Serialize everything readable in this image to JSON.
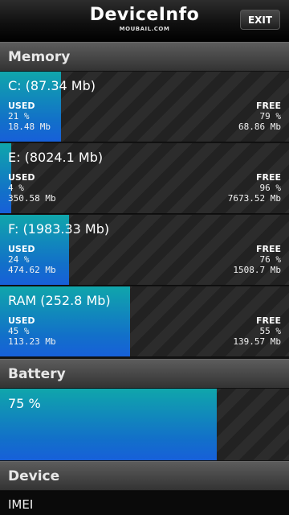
{
  "header": {
    "title": "DeviceInfo",
    "subtitle": "MOUBAIL.COM",
    "exit_label": "EXIT"
  },
  "sections": {
    "memory": "Memory",
    "battery": "Battery",
    "device": "Device"
  },
  "labels": {
    "used": "USED",
    "free": "FREE"
  },
  "memory": [
    {
      "title": "C: (87.34 Mb)",
      "used_pct": "21 %",
      "used_size": "18.48 Mb",
      "free_pct": "79 %",
      "free_size": "68.86 Mb",
      "used_fraction": 0.21
    },
    {
      "title": "E: (8024.1 Mb)",
      "used_pct": "4 %",
      "used_size": "350.58 Mb",
      "free_pct": "96 %",
      "free_size": "7673.52 Mb",
      "used_fraction": 0.04
    },
    {
      "title": "F: (1983.33 Mb)",
      "used_pct": "24 %",
      "used_size": "474.62 Mb",
      "free_pct": "76 %",
      "free_size": "1508.7 Mb",
      "used_fraction": 0.24
    },
    {
      "title": "RAM (252.8 Mb)",
      "used_pct": "45 %",
      "used_size": "113.23 Mb",
      "free_pct": "55 %",
      "free_size": "139.57 Mb",
      "used_fraction": 0.45
    }
  ],
  "battery": {
    "level_text": "75 %",
    "level_fraction": 0.75
  },
  "device": {
    "imei_label": "IMEI"
  },
  "colors": {
    "accent_top": "#10a6ab",
    "accent_bottom": "#1760d9"
  }
}
